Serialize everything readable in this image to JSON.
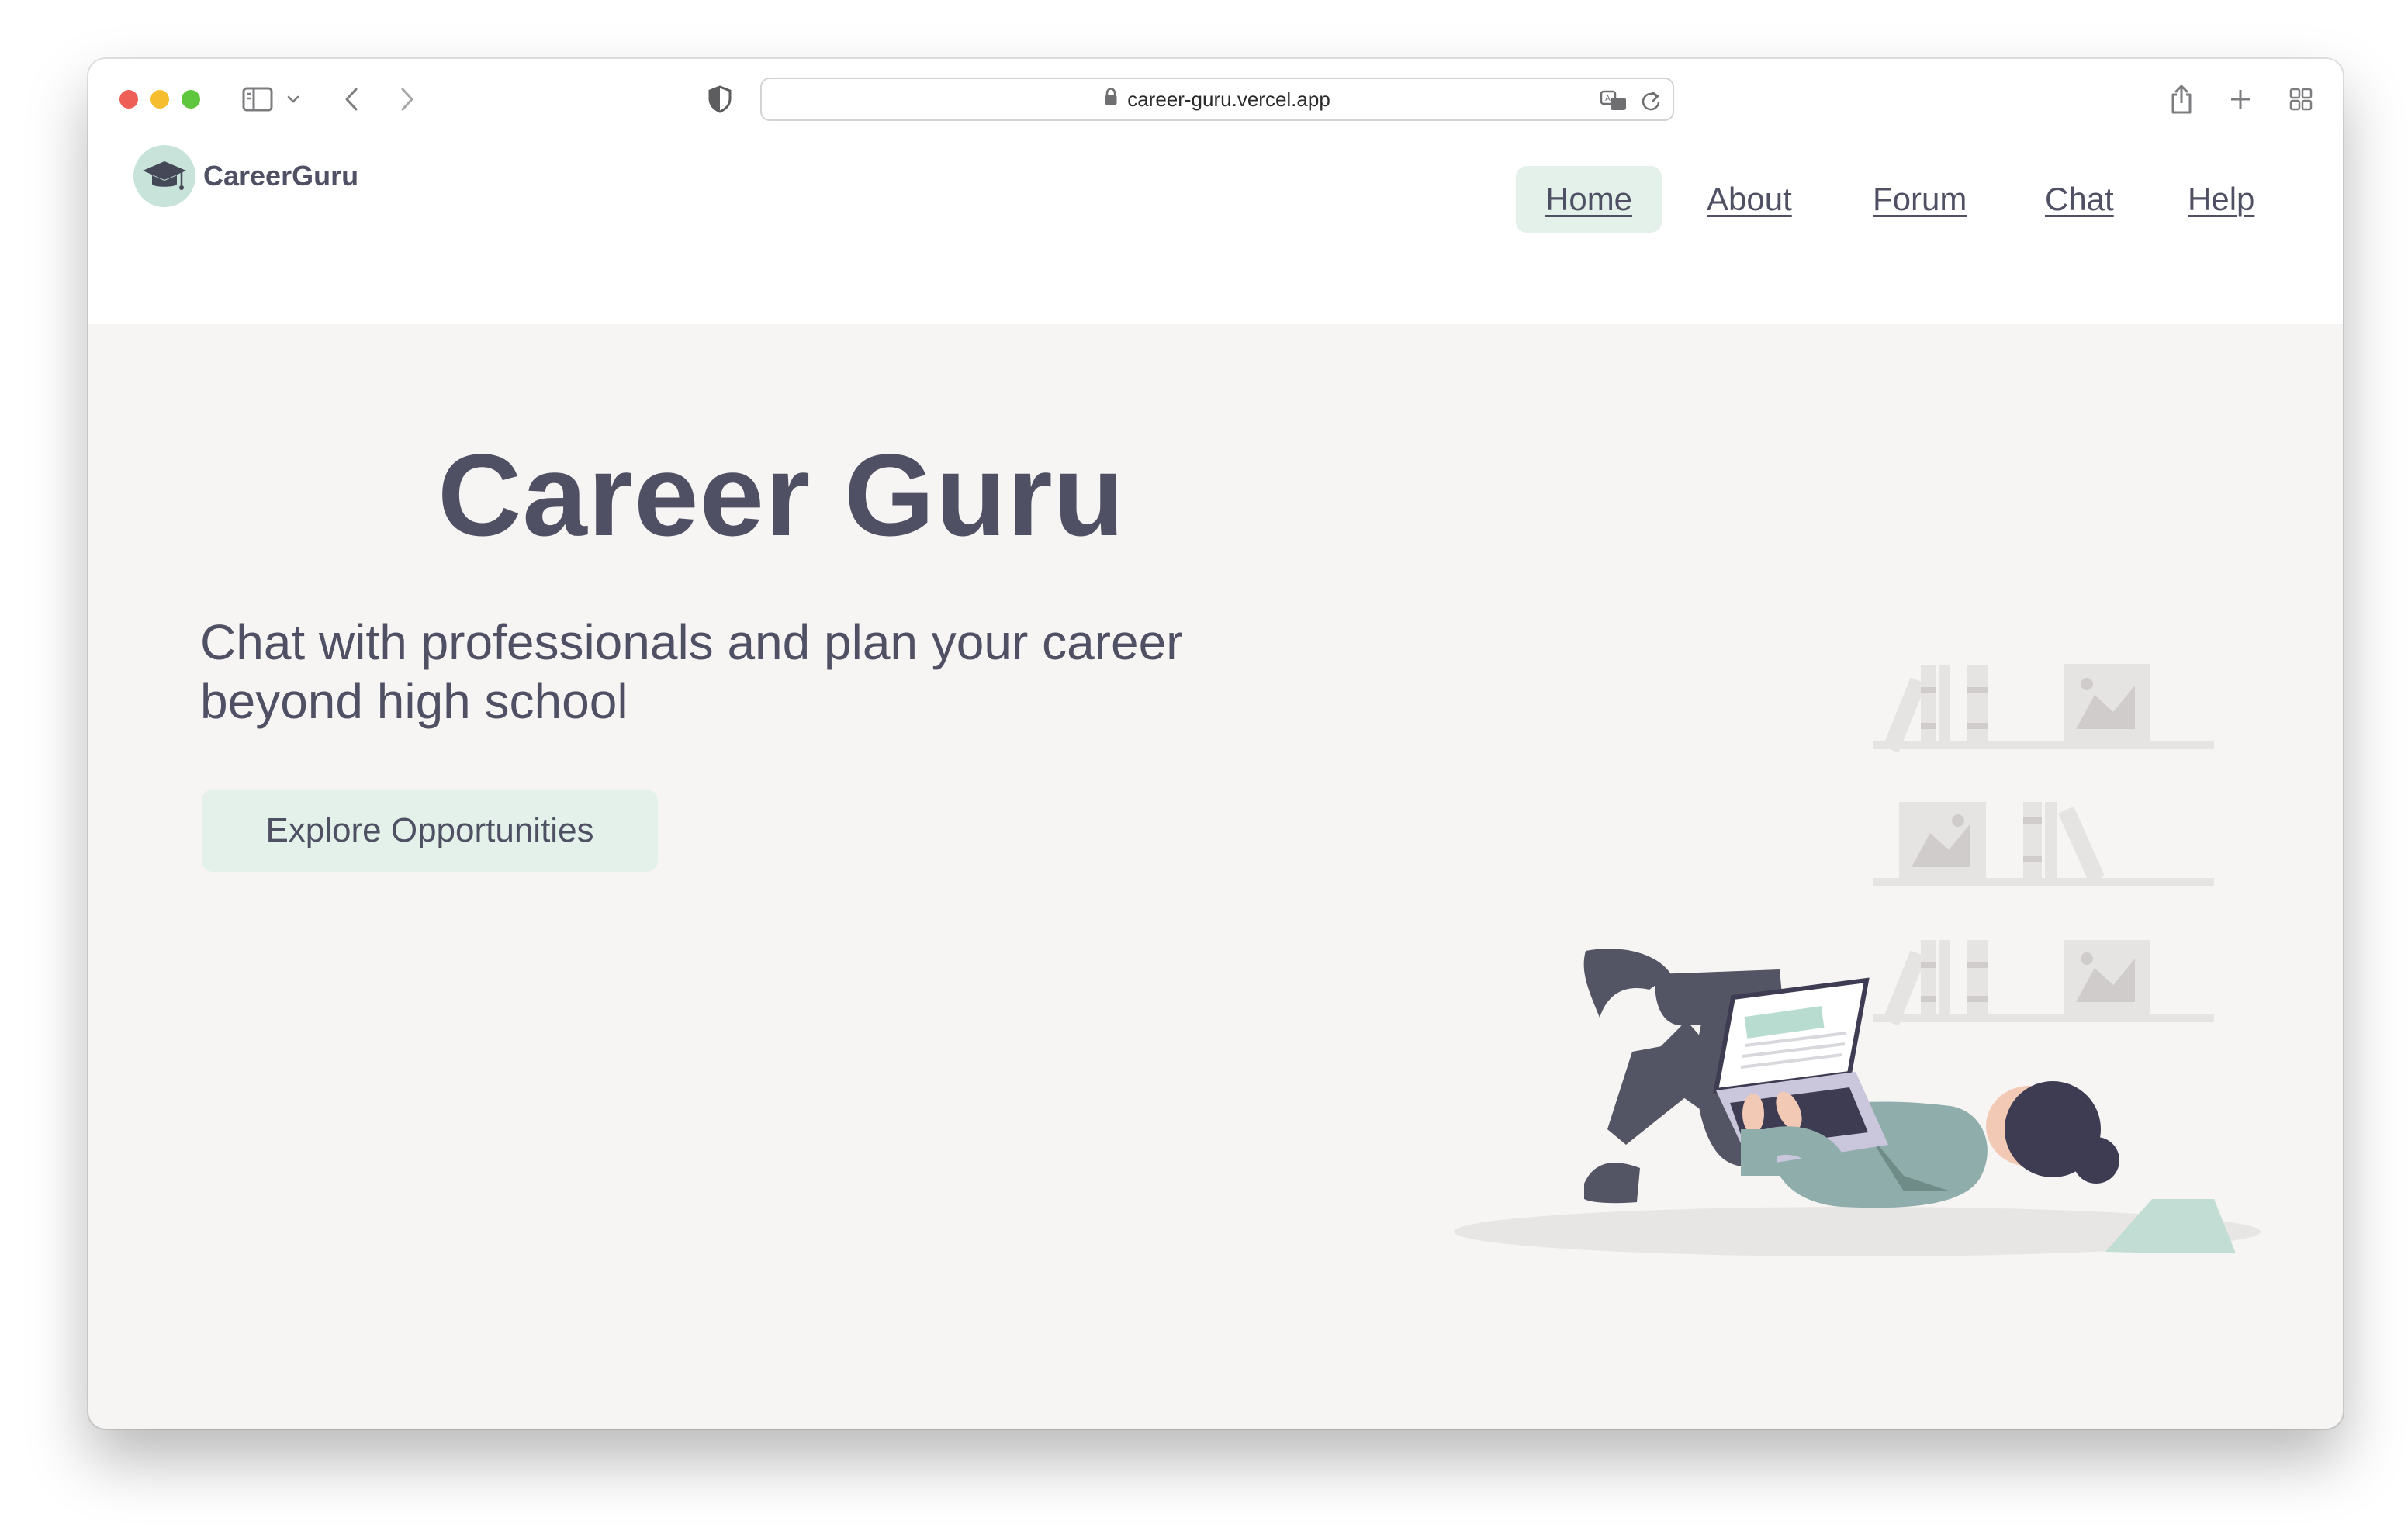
{
  "browser": {
    "url": "career-guru.vercel.app"
  },
  "site": {
    "brand": "CareerGuru",
    "nav": [
      {
        "label": "Home",
        "active": true
      },
      {
        "label": "About",
        "active": false
      },
      {
        "label": "Forum",
        "active": false
      },
      {
        "label": "Chat",
        "active": false
      },
      {
        "label": "Help",
        "active": false
      }
    ]
  },
  "hero": {
    "title": "Career Guru",
    "subtitle": "Chat with professionals and plan your career beyond high school",
    "cta_label": "Explore Opportunities"
  },
  "colors": {
    "text": "#4f5063",
    "accent_bg": "#e3f1ea",
    "page_bg": "#f7f5f4",
    "logo_bg": "#c7e3da"
  },
  "icons": [
    "sidebar-icon",
    "chevron-down-icon",
    "back-icon",
    "forward-icon",
    "shield-icon",
    "lock-icon",
    "translate-icon",
    "reload-icon",
    "share-icon",
    "new-tab-icon",
    "tab-overview-icon",
    "graduation-cap-icon"
  ]
}
